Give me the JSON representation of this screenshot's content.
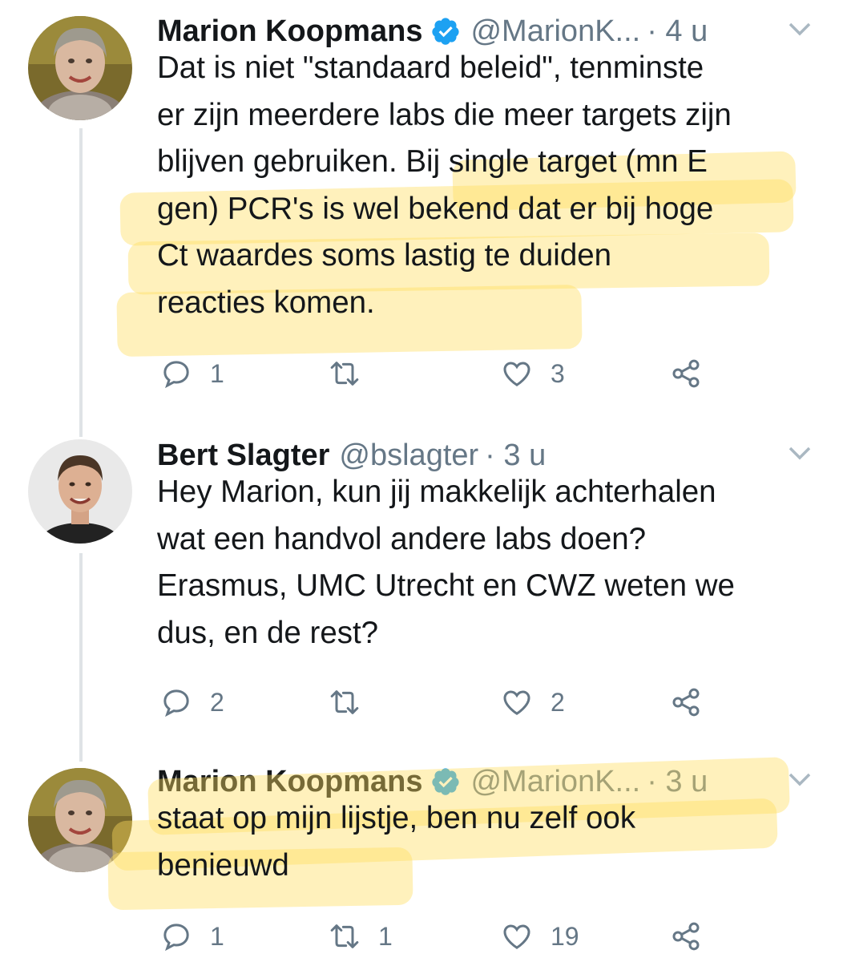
{
  "tweets": [
    {
      "name": "Marion Koopmans",
      "verified": true,
      "handle": "@MarionK...",
      "time": "· 4 u",
      "lines": [
        "Dat is niet \"standaard beleid\", tenminste",
        "er zijn meerdere labs die meer targets zijn",
        "blijven gebruiken. Bij single target (mn E",
        "gen) PCR's is wel bekend dat er bij hoge",
        "Ct waardes soms lastig te duiden",
        "reacties komen."
      ],
      "reply_count": "1",
      "retweet_count": "",
      "like_count": "3"
    },
    {
      "name": "Bert Slagter",
      "verified": false,
      "handle": "@bslagter",
      "time": "· 3 u",
      "lines": [
        "Hey Marion, kun jij makkelijk achterhalen",
        "wat een handvol andere labs doen?",
        "Erasmus, UMC Utrecht en CWZ weten we",
        "dus, en de rest?"
      ],
      "reply_count": "2",
      "retweet_count": "",
      "like_count": "2"
    },
    {
      "name": "Marion Koopmans",
      "verified": true,
      "handle": "@MarionK...",
      "time": "· 3 u",
      "lines": [
        "staat op mijn lijstje, ben nu zelf ook",
        "benieuwd"
      ],
      "reply_count": "1",
      "retweet_count": "1",
      "like_count": "19"
    }
  ],
  "icons": {
    "reply": "reply-icon",
    "retweet": "retweet-icon",
    "like": "heart-icon",
    "share": "share-icon",
    "verified": "verified-badge-icon",
    "menu": "chevron-down-icon"
  },
  "colors": {
    "text": "#14171a",
    "secondary": "#657786",
    "verified": "#1da1f2",
    "highlight": "#ffde5f",
    "thread_line": "#dfe3e6"
  }
}
